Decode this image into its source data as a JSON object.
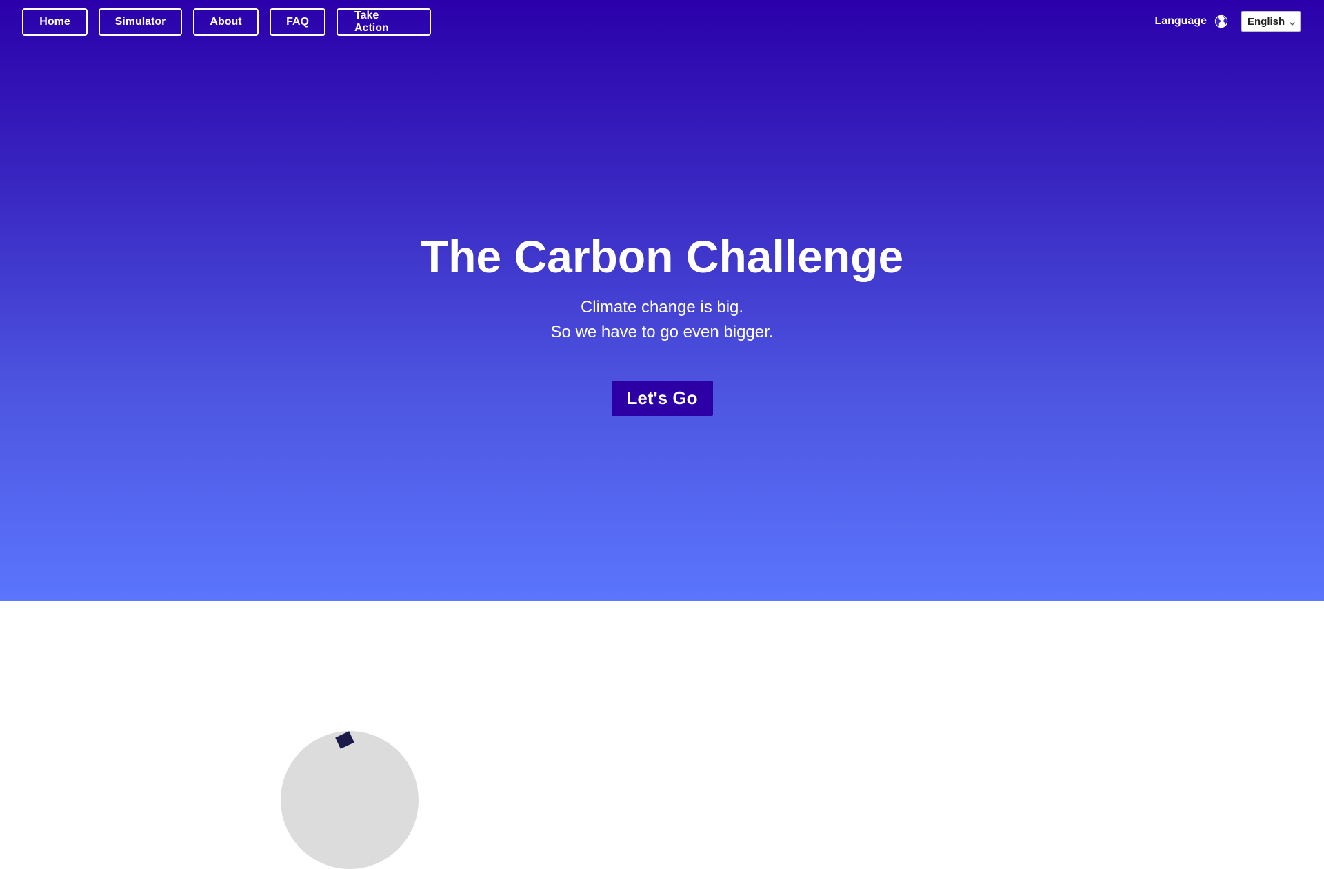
{
  "nav": {
    "items": [
      {
        "label": "Home"
      },
      {
        "label": "Simulator"
      },
      {
        "label": "About"
      },
      {
        "label": "FAQ"
      },
      {
        "label": "Take Action"
      }
    ]
  },
  "language": {
    "label": "Language",
    "icon": "globe-icon",
    "selected": "English"
  },
  "hero": {
    "title": "The Carbon Challenge",
    "subtitle_line1": "Climate change is big.",
    "subtitle_line2": "So we have to go even bigger.",
    "cta_label": "Let's Go"
  },
  "colors": {
    "hero_top": "#2b00aa",
    "hero_bottom": "#5b75fc",
    "cta_bg": "#2c00a5",
    "text": "#ffffff"
  }
}
